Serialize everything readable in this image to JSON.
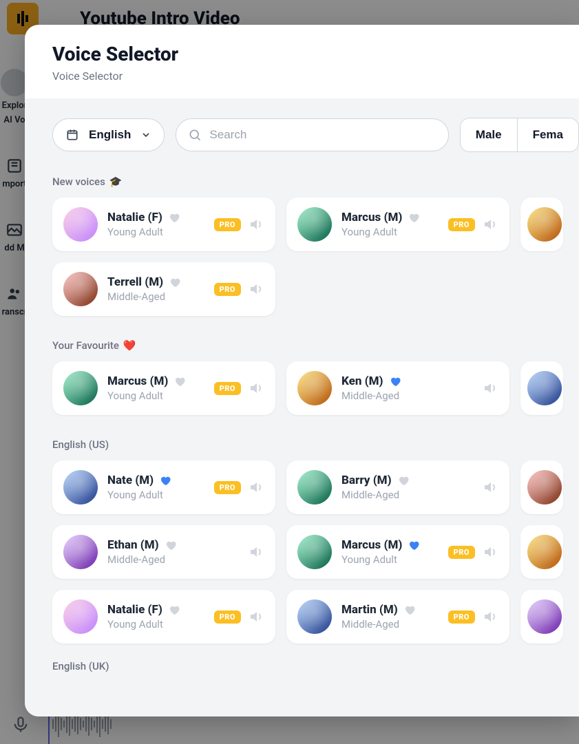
{
  "background": {
    "title": "Youtube Intro Video",
    "side": {
      "explore1": "Explor",
      "explore2": "AI Vo",
      "import": "mport",
      "addmedia": "dd M",
      "transcribe": "ranscr"
    }
  },
  "modal": {
    "title": "Voice Selector",
    "subtitle": "Voice Selector"
  },
  "controls": {
    "language": "English",
    "search_placeholder": "Search",
    "gender_male": "Male",
    "gender_female": "Fema"
  },
  "badges": {
    "pro": "PRO"
  },
  "sections": {
    "new": {
      "title": "New voices",
      "emoji": "🎓"
    },
    "fav": {
      "title": "Your Favourite",
      "emoji": "❤️"
    },
    "en_us": {
      "title": "English (US)"
    },
    "en_uk": {
      "title": "English (UK)"
    }
  },
  "voices": {
    "new_0": {
      "name": "Natalie (F)",
      "sub": "Young Adult"
    },
    "new_1": {
      "name": "Marcus (M)",
      "sub": "Young Adult"
    },
    "new_2": {
      "name": "Terrell (M)",
      "sub": "Middle-Aged"
    },
    "fav_0": {
      "name": "Marcus (M)",
      "sub": "Young Adult"
    },
    "fav_1": {
      "name": "Ken (M)",
      "sub": "Middle-Aged"
    },
    "us_0": {
      "name": "Nate (M)",
      "sub": "Young Adult"
    },
    "us_1": {
      "name": "Barry (M)",
      "sub": "Middle-Aged"
    },
    "us_2": {
      "name": "Ethan (M)",
      "sub": "Middle-Aged"
    },
    "us_3": {
      "name": "Marcus (M)",
      "sub": "Young Adult"
    },
    "us_4": {
      "name": "Natalie (F)",
      "sub": "Young Adult"
    },
    "us_5": {
      "name": "Martin (M)",
      "sub": "Middle-Aged"
    }
  }
}
